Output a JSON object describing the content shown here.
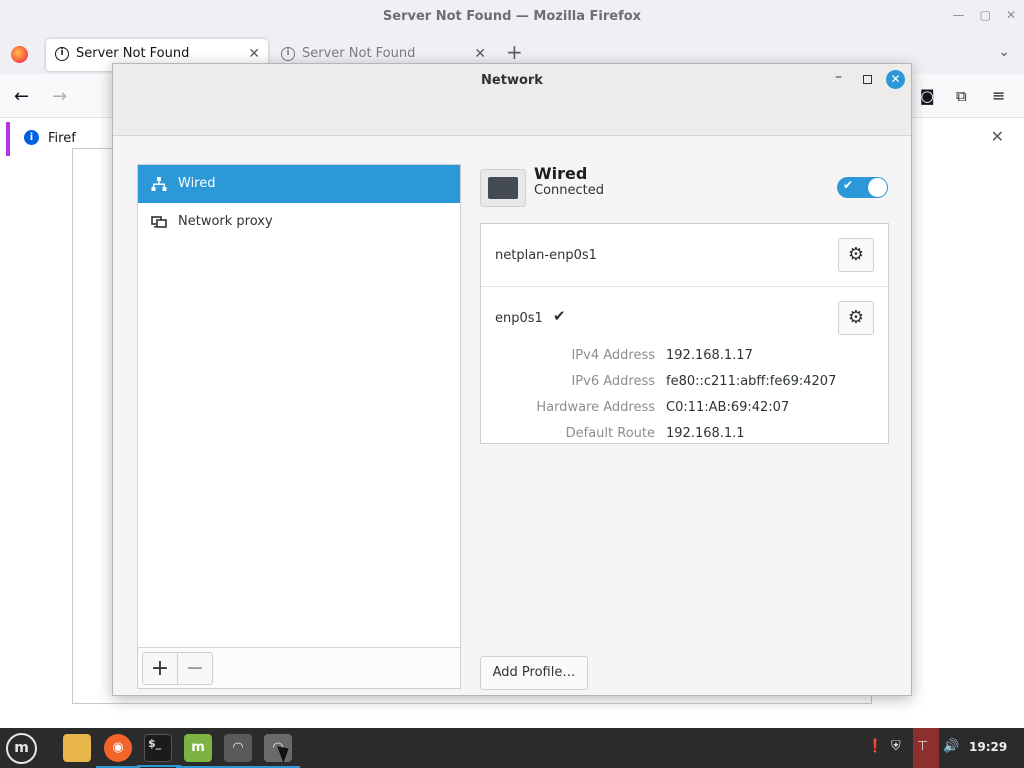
{
  "firefox": {
    "window_title": "Server Not Found — Mozilla Firefox",
    "tabs": [
      {
        "label": "Server Not Found",
        "active": true
      },
      {
        "label": "Server Not Found",
        "active": false
      }
    ],
    "notice_text": "Firef"
  },
  "network": {
    "title": "Network",
    "sidebar": {
      "items": [
        {
          "label": "Wired",
          "icon": "wired-network-icon",
          "selected": true
        },
        {
          "label": "Network proxy",
          "icon": "network-proxy-icon",
          "selected": false
        }
      ],
      "add_label": "+",
      "remove_label": "−"
    },
    "wired": {
      "title": "Wired",
      "status": "Connected",
      "enabled": true
    },
    "profiles": [
      {
        "name": "netplan-enp0s1",
        "active": false
      },
      {
        "name": "enp0s1",
        "active": true
      }
    ],
    "details": [
      {
        "label": "IPv4 Address",
        "value": "192.168.1.17"
      },
      {
        "label": "IPv6 Address",
        "value": "fe80::c211:abff:fe69:4207"
      },
      {
        "label": "Hardware Address",
        "value": "C0:11:AB:69:42:07"
      },
      {
        "label": "Default Route",
        "value": "192.168.1.1"
      }
    ],
    "add_profile_label": "Add Profile…"
  },
  "taskbar": {
    "clock": "19:29",
    "apps": [
      "files",
      "firefox",
      "terminal",
      "mintupdate",
      "network",
      "network-settings"
    ]
  },
  "colors": {
    "accent": "#2c98d8",
    "taskbar": "#2b2b2b",
    "network_tray_active": "#8e2f2f"
  }
}
